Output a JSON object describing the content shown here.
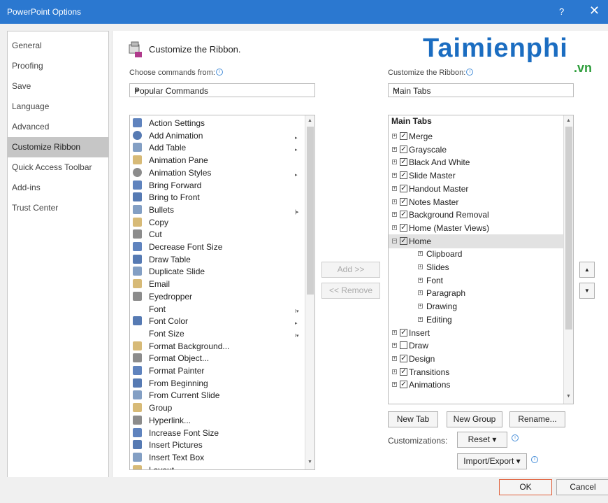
{
  "window": {
    "title": "PowerPoint Options",
    "help": "?",
    "close": "✕"
  },
  "nav": {
    "items": [
      "General",
      "Proofing",
      "Save",
      "Language",
      "Advanced",
      "Customize Ribbon",
      "Quick Access Toolbar",
      "Add-ins",
      "Trust Center"
    ],
    "selected": "Customize Ribbon"
  },
  "header": {
    "title": "Customize the Ribbon."
  },
  "watermark": {
    "main": "Taimienphi",
    "suffix": ".vn"
  },
  "left": {
    "label": "Choose commands from:",
    "dropdown": "Popular Commands",
    "commands": [
      {
        "label": "Action Settings",
        "icon": "action-settings-icon"
      },
      {
        "label": "Add Animation",
        "icon": "star-icon",
        "submenu": "▸"
      },
      {
        "label": "Add Table",
        "icon": "table-icon",
        "submenu": "▸"
      },
      {
        "label": "Animation Pane",
        "icon": "animation-pane-icon"
      },
      {
        "label": "Animation Styles",
        "icon": "star-icon",
        "submenu": "▸"
      },
      {
        "label": "Bring Forward",
        "icon": "bring-forward-icon"
      },
      {
        "label": "Bring to Front",
        "icon": "bring-to-front-icon"
      },
      {
        "label": "Bullets",
        "icon": "bullets-icon",
        "submenu": "|▸"
      },
      {
        "label": "Copy",
        "icon": "copy-icon"
      },
      {
        "label": "Cut",
        "icon": "scissors-icon"
      },
      {
        "label": "Decrease Font Size",
        "icon": "decrease-font-icon"
      },
      {
        "label": "Draw Table",
        "icon": "draw-table-icon"
      },
      {
        "label": "Duplicate Slide",
        "icon": "duplicate-slide-icon"
      },
      {
        "label": "Email",
        "icon": "email-icon"
      },
      {
        "label": "Eyedropper",
        "icon": "eyedropper-icon"
      },
      {
        "label": "Font",
        "icon": "",
        "submenu": "I▾"
      },
      {
        "label": "Font Color",
        "icon": "font-color-icon",
        "submenu": "▸"
      },
      {
        "label": "Font Size",
        "icon": "",
        "submenu": "I▾"
      },
      {
        "label": "Format Background...",
        "icon": "format-background-icon"
      },
      {
        "label": "Format Object...",
        "icon": "format-object-icon"
      },
      {
        "label": "Format Painter",
        "icon": "format-painter-icon"
      },
      {
        "label": "From Beginning",
        "icon": "from-beginning-icon"
      },
      {
        "label": "From Current Slide",
        "icon": "from-current-icon"
      },
      {
        "label": "Group",
        "icon": "group-icon"
      },
      {
        "label": "Hyperlink...",
        "icon": "hyperlink-icon"
      },
      {
        "label": "Increase Font Size",
        "icon": "increase-font-icon"
      },
      {
        "label": "Insert Pictures",
        "icon": "insert-pictures-icon"
      },
      {
        "label": "Insert Text Box",
        "icon": "text-box-icon"
      },
      {
        "label": "Layout",
        "icon": "layout-icon"
      }
    ]
  },
  "middle": {
    "add": "Add >>",
    "remove": "<< Remove"
  },
  "right": {
    "label": "Customize the Ribbon:",
    "dropdown": "Main Tabs",
    "header": "Main Tabs",
    "tree": [
      {
        "label": "Merge",
        "level": 0,
        "checked": true,
        "expander": "+"
      },
      {
        "label": "Grayscale",
        "level": 0,
        "checked": true,
        "expander": "+"
      },
      {
        "label": "Black And White",
        "level": 0,
        "checked": true,
        "expander": "+"
      },
      {
        "label": "Slide Master",
        "level": 0,
        "checked": true,
        "expander": "+"
      },
      {
        "label": "Handout Master",
        "level": 0,
        "checked": true,
        "expander": "+"
      },
      {
        "label": "Notes Master",
        "level": 0,
        "checked": true,
        "expander": "+"
      },
      {
        "label": "Background Removal",
        "level": 0,
        "checked": true,
        "expander": "+"
      },
      {
        "label": "Home (Master Views)",
        "level": 0,
        "checked": true,
        "expander": "+"
      },
      {
        "label": "Home",
        "level": 0,
        "checked": true,
        "expander": "−",
        "selected": true
      },
      {
        "label": "Clipboard",
        "level": 1,
        "expander": "+"
      },
      {
        "label": "Slides",
        "level": 1,
        "expander": "+"
      },
      {
        "label": "Font",
        "level": 1,
        "expander": "+"
      },
      {
        "label": "Paragraph",
        "level": 1,
        "expander": "+"
      },
      {
        "label": "Drawing",
        "level": 1,
        "expander": "+"
      },
      {
        "label": "Editing",
        "level": 1,
        "expander": "+"
      },
      {
        "label": "Insert",
        "level": 0,
        "checked": true,
        "expander": "+"
      },
      {
        "label": "Draw",
        "level": 0,
        "checked": false,
        "expander": "+"
      },
      {
        "label": "Design",
        "level": 0,
        "checked": true,
        "expander": "+"
      },
      {
        "label": "Transitions",
        "level": 0,
        "checked": true,
        "expander": "+"
      },
      {
        "label": "Animations",
        "level": 0,
        "checked": true,
        "expander": "+"
      }
    ],
    "new_tab": "New Tab",
    "new_group": "New Group",
    "rename": "Rename...",
    "customizations_label": "Customizations:",
    "reset": "Reset ▾",
    "import_export": "Import/Export ▾",
    "move_up": "▲",
    "move_down": "▼"
  },
  "footer": {
    "ok": "OK",
    "cancel": "Cancel"
  },
  "colors": {
    "titlebar": "#2b78d0",
    "watermark_blue": "#1b6dc1",
    "watermark_green": "#2d9d3a",
    "ok_border": "#e0603c"
  }
}
